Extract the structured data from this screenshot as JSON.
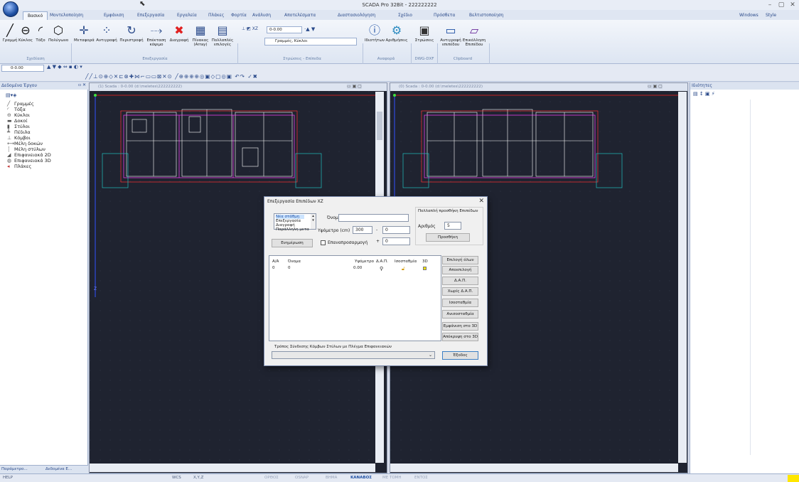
{
  "window": {
    "title": "SCADA Pro 32Bit - 222222222",
    "min": "–",
    "max": "▢",
    "close": "✕"
  },
  "tabs": [
    "Βασικό",
    "Μοντελοποίηση",
    "Εμφάνιση",
    "Επεξεργασία",
    "Εργαλεία",
    "Πλάκες",
    "Φορτία",
    "Ανάλυση",
    "Αποτελέσματα",
    "Διαστασιολόγηση",
    "Σχέδιο",
    "Πρόσθετα",
    "Βελτιστοποίηση"
  ],
  "tabs_right": {
    "windows": "Windows",
    "style": "Style"
  },
  "ribbon": {
    "draw": [
      "Γραμμή",
      "Κύκλος",
      "Τόξο",
      "Πολύγωνο"
    ],
    "draw_group": "Σχεδίαση",
    "edit": [
      "Μεταφορά",
      "Αντιγραφή",
      "Περιστροφή",
      "Επέκταση",
      "Διαγραφή",
      "Πίνακας",
      "Πολλαπλές"
    ],
    "edit_sub": [
      "κόψιμο",
      "(Array)",
      "επιλογές"
    ],
    "edit_group": "Επεξεργασία",
    "level_value": "0-0.00",
    "level_combo": "Γραμμές, Κύκλοι",
    "levels_group": "Στρώσεις - Επίπεδα",
    "ref": [
      "Ιδιοτήτων",
      "Αριθμήσεις"
    ],
    "ref_group": "Αναφορά",
    "dwg": "Στρώσεις",
    "dwg_group": "DWG-DXF",
    "clip": [
      "Αντιγραφή",
      "Επικόλληση",
      "επιπέδου",
      "Επιπέδου"
    ],
    "clip_group": "Clipboard"
  },
  "row1": {
    "level": "0-0.00"
  },
  "left_panel": {
    "title": "Δεδομένα Έργου",
    "items": [
      "Γραμμές",
      "Τόξα",
      "Κύκλοι",
      "Δοκοί",
      "Στύλοι",
      "Πέδιλα",
      "Κόμβοι",
      "Μέλη δοκών",
      "Μέλη στύλων",
      "Επιφανειακά 2D",
      "Επιφανειακά 3D",
      "Πλάκες"
    ],
    "tab1": "Παράμετρο...",
    "tab2": "Δεδομένα Ε..."
  },
  "viewports": [
    {
      "title": "(1) Scada : 0-0.00 (d:\\meletes\\222222222)"
    },
    {
      "title": "(0) Scada : 0-0.00 (d:\\meletes\\222222222)"
    }
  ],
  "axis": {
    "z": "Z"
  },
  "right_panel": {
    "title": "Ιδιότητες"
  },
  "status": [
    "HELP",
    "WCS",
    "X,Y,Z",
    "ΟΡΘΟΣ",
    "OSNAP",
    "ΒΗΜΑ",
    "ΚΑΝΑΒΟΣ",
    "ΜΕ ΤΟΜΗ",
    "ΕΝΤΟΣ"
  ],
  "dialog": {
    "title": "Επεξεργασία Επιπέδων ΧΖ",
    "list": [
      "Νέα στάθμη",
      "Επεξεργασία",
      "Διαγραφή",
      "Παράλληλη μετα"
    ],
    "name_label": "Όνομα",
    "height_label": "Υψόμετρο (cm)",
    "height_value": "300",
    "minus": "-",
    "plus": "+",
    "minus_val": "0",
    "plus_val": "0",
    "update": "Ενημέρωση",
    "readjust": "Επαναπροσαρμογή",
    "multi_title": "Πολλαπλή προσθήκη Επιπέδων",
    "count_label": "Αριθμός",
    "count_value": "5",
    "add": "Προσθήκη",
    "columns": [
      "Α/Α",
      "Όνομα",
      "Υψόμετρο",
      "Δ.Α.Π.",
      "Ισοσταθμία",
      "3D"
    ],
    "row": {
      "aa": "0",
      "name": "0",
      "height": "0.00"
    },
    "buttons": [
      "Επιλογή όλων",
      "Αποεπιλογή",
      "Δ.Α.Π.",
      "Χωρίς Δ.Α.Π.",
      "Ισοσταθμία",
      "Ανισοσταθμία",
      "Εμφάνιση στο 3D",
      "Απόκρυψη στο 3D"
    ],
    "mode_label": "Τρόπος Σύνδεσης Κόμβων Στύλων με Πλέγμα Επιφανειακών",
    "exit": "Έξοδος"
  }
}
